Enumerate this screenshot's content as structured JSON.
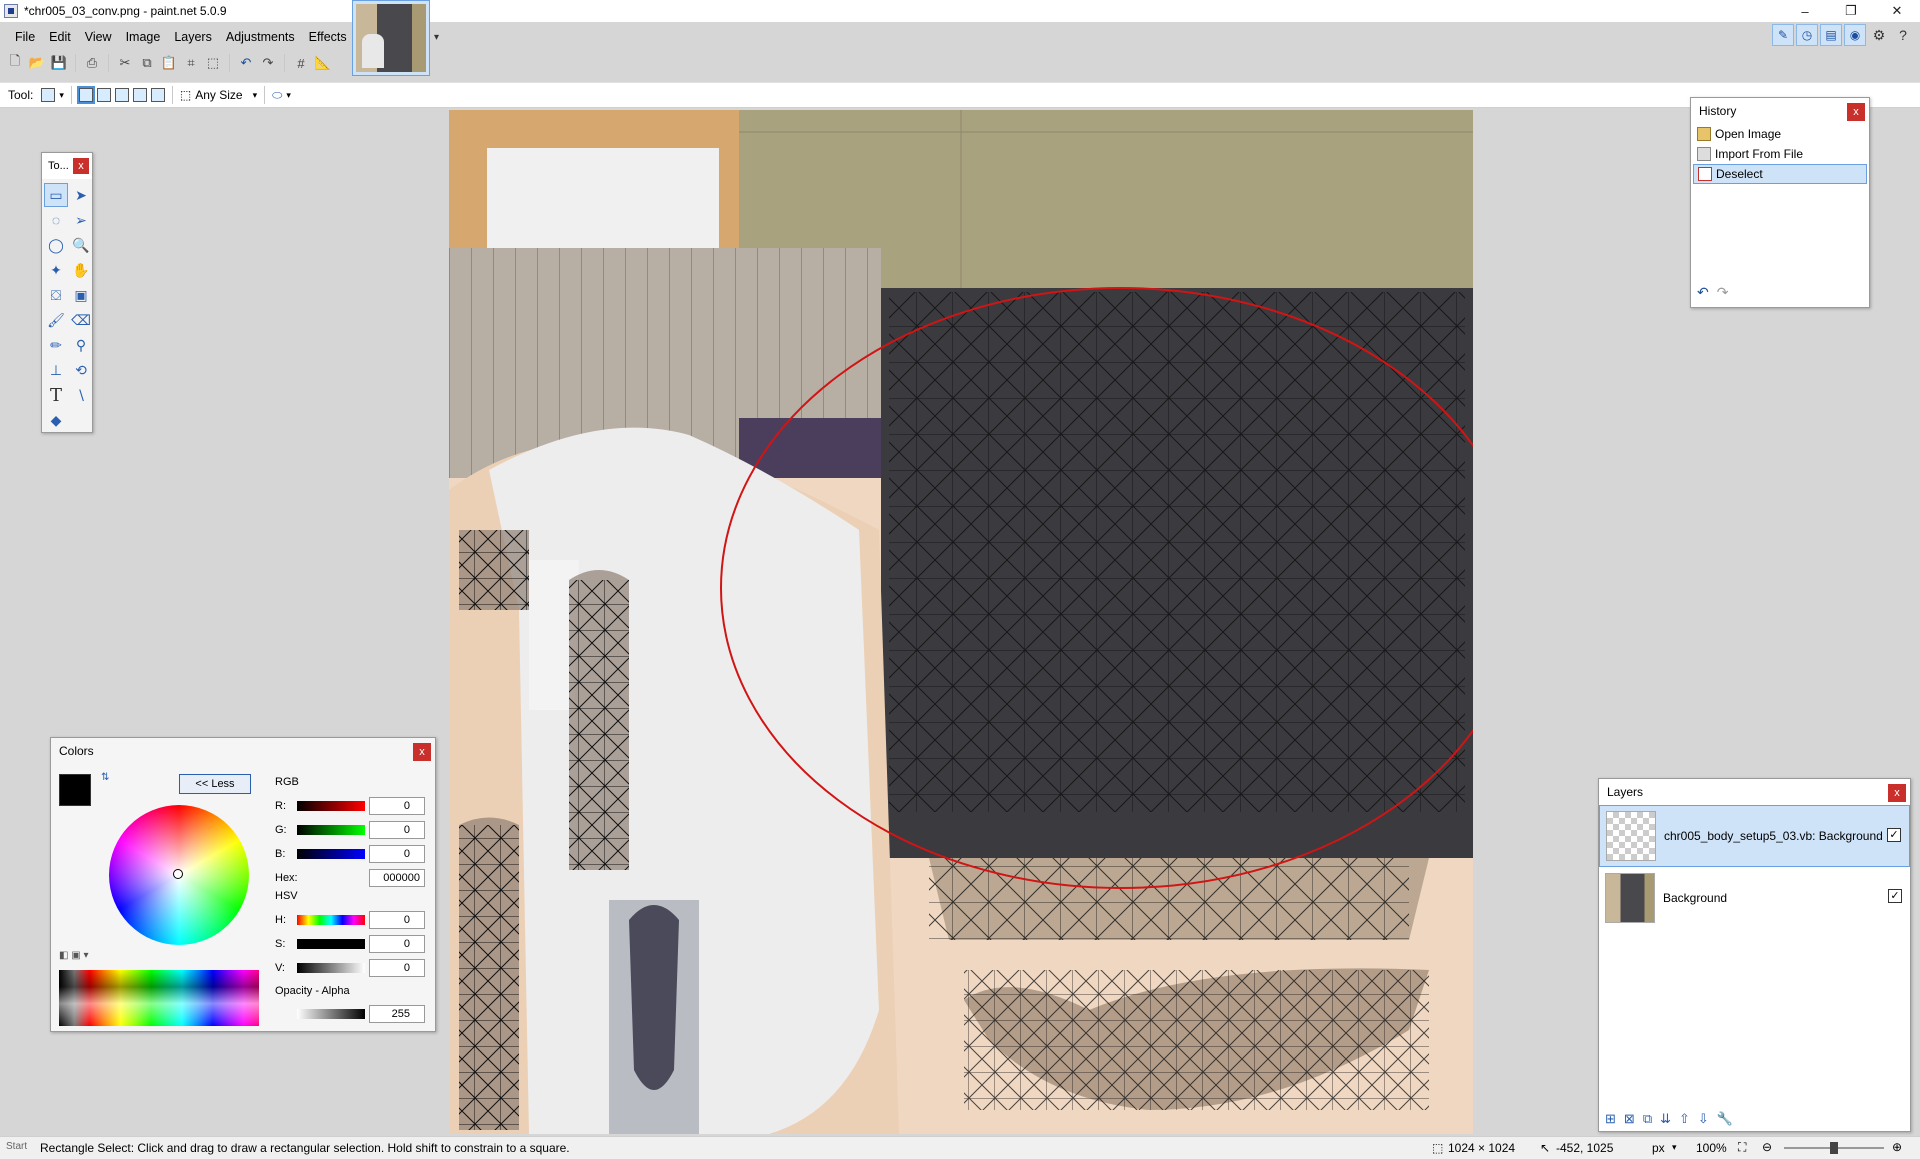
{
  "window": {
    "title": "*chr005_03_conv.png - paint.net 5.0.9",
    "min": "–",
    "restore": "❐",
    "close": "✕"
  },
  "menu": {
    "items": [
      "File",
      "Edit",
      "View",
      "Image",
      "Layers",
      "Adjustments",
      "Effects"
    ]
  },
  "toolbar": {
    "tool_label": "Tool:",
    "size_mode": "Any Size"
  },
  "tools_panel": {
    "title": "To...",
    "close": "x"
  },
  "history": {
    "title": "History",
    "close": "x",
    "items": [
      "Open Image",
      "Import From File",
      "Deselect"
    ],
    "selected_index": 2
  },
  "colors": {
    "title": "Colors",
    "close": "x",
    "less_button": "<< Less",
    "rgb_label": "RGB",
    "r_label": "R:",
    "g_label": "G:",
    "b_label": "B:",
    "r": "0",
    "g": "0",
    "b": "0",
    "hex_label": "Hex:",
    "hex": "000000",
    "hsv_label": "HSV",
    "h_label": "H:",
    "s_label": "S:",
    "v_label": "V:",
    "h": "0",
    "s": "0",
    "v": "0",
    "opacity_label": "Opacity - Alpha",
    "alpha": "255",
    "primary": "#000000",
    "secondary": "#ffffff"
  },
  "layers": {
    "title": "Layers",
    "close": "x",
    "items": [
      {
        "name": "chr005_body_setup5_03.vb: Background",
        "visible": true
      },
      {
        "name": "Background",
        "visible": true
      }
    ]
  },
  "status": {
    "hint": "Rectangle Select: Click and drag to draw a rectangular selection. Hold shift to constrain to a square.",
    "start": "Start",
    "image_size": "1024 × 1024",
    "cursor": "-452, 1025",
    "unit": "px",
    "zoom": "100%"
  },
  "theme": {
    "accent": "#4a90d9",
    "selection_red": "#d11414",
    "close_red": "#c9302c"
  }
}
